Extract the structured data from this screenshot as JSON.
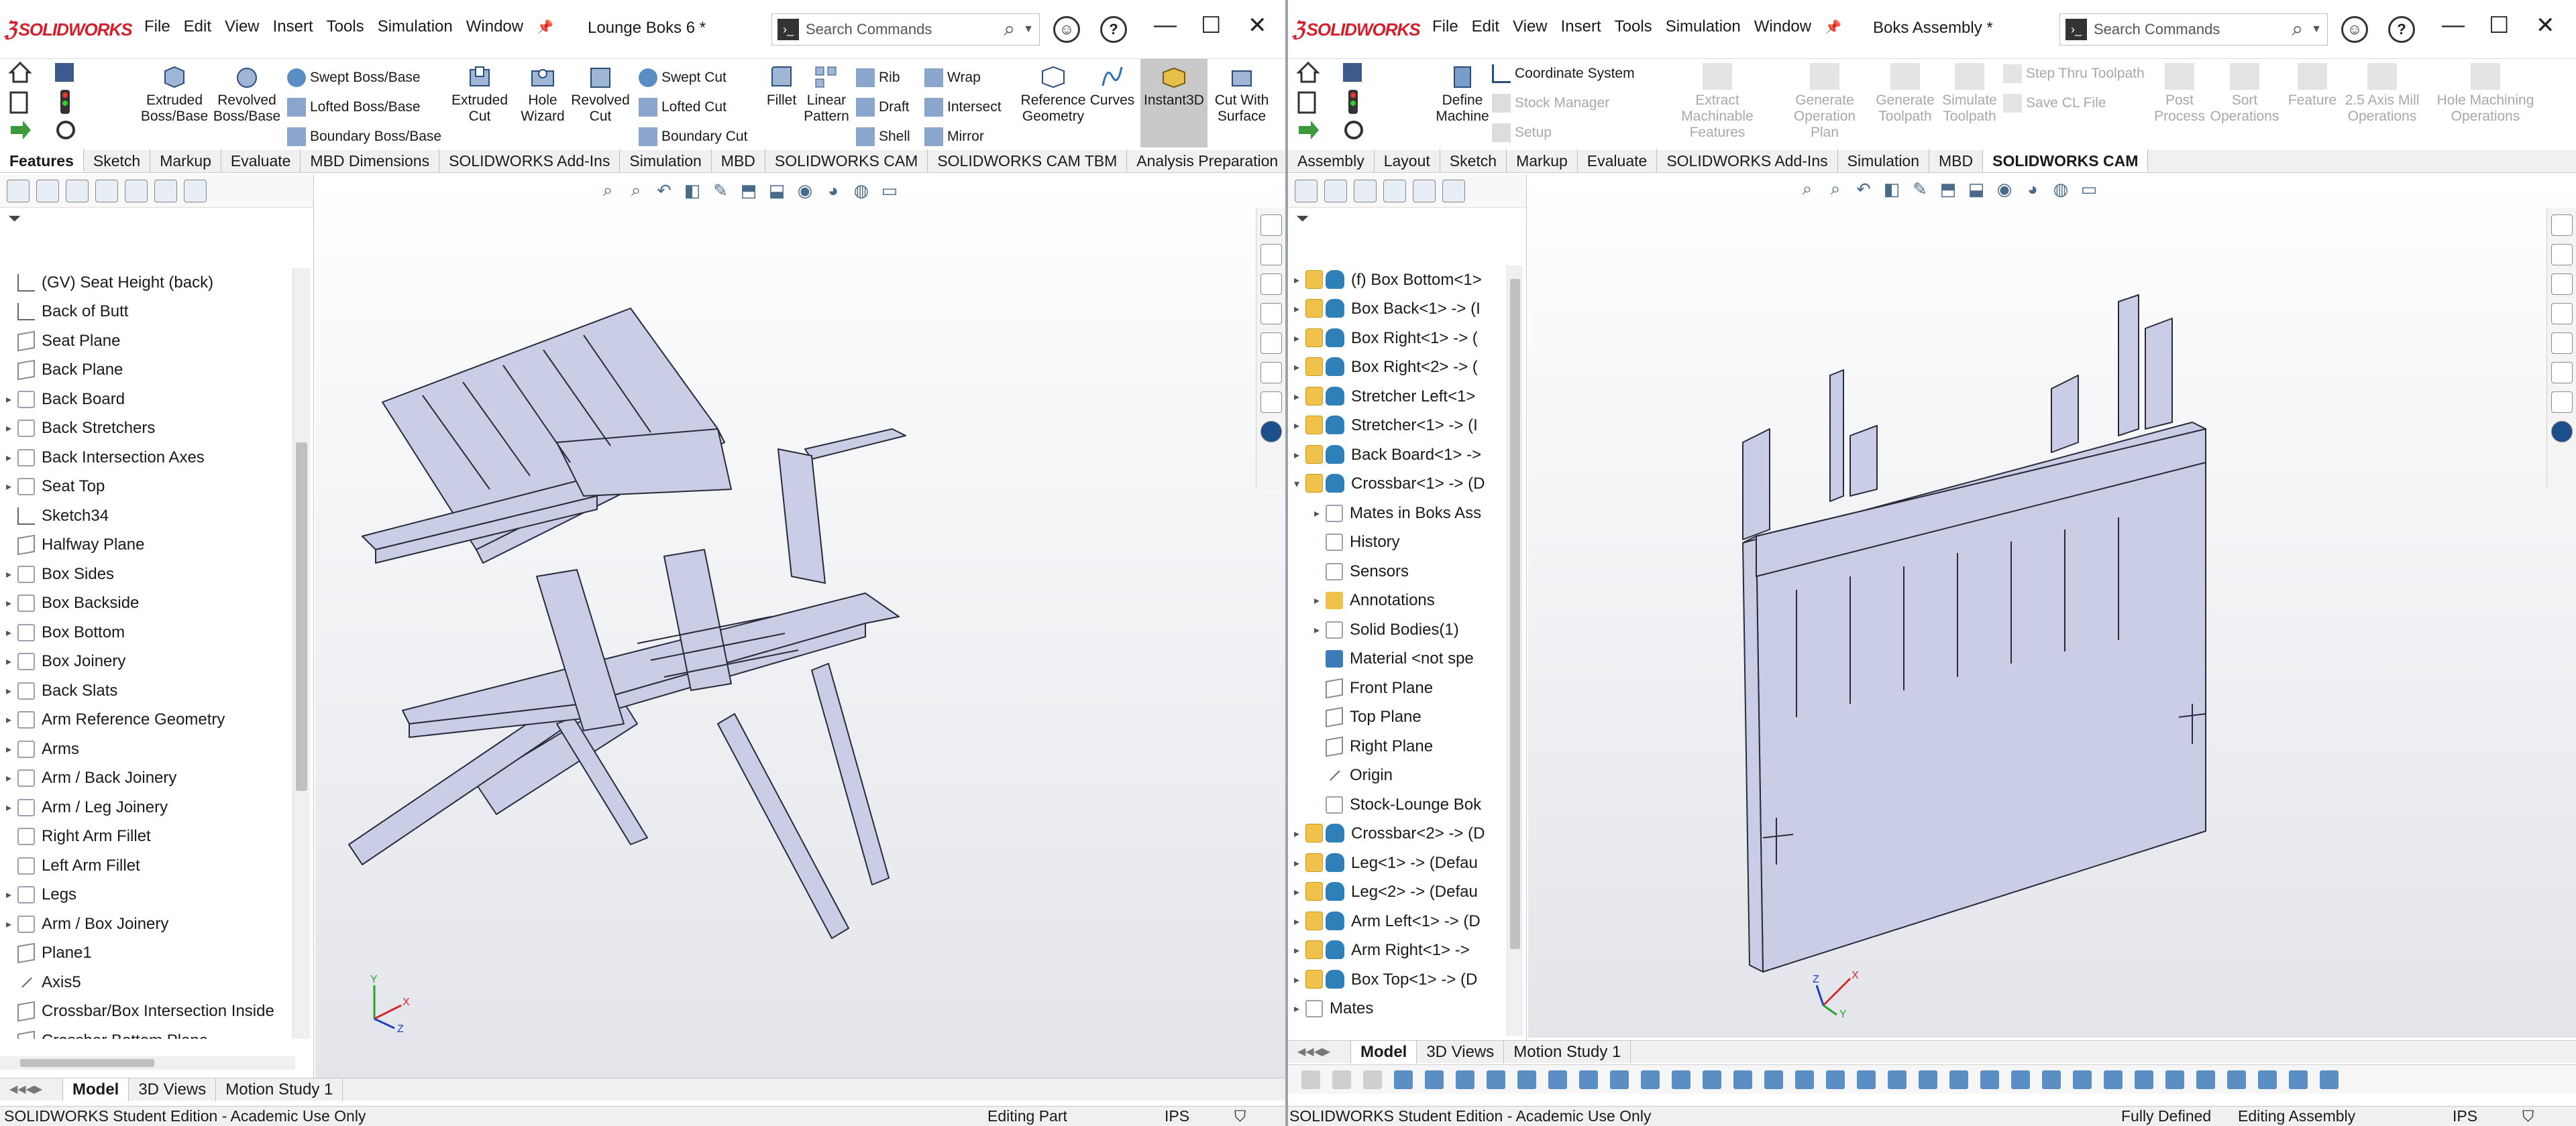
{
  "left": {
    "logo": "SOLIDWORKS",
    "menu": [
      "File",
      "Edit",
      "View",
      "Insert",
      "Tools",
      "Simulation",
      "Window"
    ],
    "doc_title": "Lounge Boks 6 *",
    "search_placeholder": "Search Commands",
    "ribbon": {
      "extruded_boss": "Extruded Boss/Base",
      "revolved_boss": "Revolved Boss/Base",
      "swept_boss": "Swept Boss/Base",
      "lofted_boss": "Lofted Boss/Base",
      "boundary_boss": "Boundary Boss/Base",
      "extruded_cut": "Extruded Cut",
      "hole_wizard": "Hole Wizard",
      "revolved_cut": "Revolved Cut",
      "swept_cut": "Swept Cut",
      "lofted_cut": "Lofted Cut",
      "boundary_cut": "Boundary Cut",
      "fillet": "Fillet",
      "linear_pattern": "Linear Pattern",
      "rib": "Rib",
      "draft": "Draft",
      "shell": "Shell",
      "wrap": "Wrap",
      "intersect": "Intersect",
      "mirror": "Mirror",
      "reference_geometry": "Reference Geometry",
      "curves": "Curves",
      "instant3d": "Instant3D",
      "cut_with_surface": "Cut With Surface"
    },
    "tabs": [
      "Features",
      "Sketch",
      "Markup",
      "Evaluate",
      "MBD Dimensions",
      "SOLIDWORKS Add-Ins",
      "Simulation",
      "MBD",
      "SOLIDWORKS CAM",
      "SOLIDWORKS CAM TBM",
      "Analysis Preparation"
    ],
    "tree": [
      {
        "label": "(GV) Seat Height (back)",
        "icon": "sketch",
        "expand": false
      },
      {
        "label": "Back of Butt",
        "icon": "sketch",
        "expand": false
      },
      {
        "label": "Seat Plane",
        "icon": "plane",
        "expand": false
      },
      {
        "label": "Back Plane",
        "icon": "plane",
        "expand": false
      },
      {
        "label": "Back Board",
        "icon": "folder",
        "expand": true
      },
      {
        "label": "Back Stretchers",
        "icon": "folder",
        "expand": true
      },
      {
        "label": "Back Intersection Axes",
        "icon": "folder",
        "expand": true
      },
      {
        "label": "Seat Top",
        "icon": "folder",
        "expand": true
      },
      {
        "label": "Sketch34",
        "icon": "sketch",
        "expand": false
      },
      {
        "label": "Halfway Plane",
        "icon": "plane",
        "expand": false
      },
      {
        "label": "Box Sides",
        "icon": "folder",
        "expand": true
      },
      {
        "label": "Box Backside",
        "icon": "folder",
        "expand": true
      },
      {
        "label": "Box Bottom",
        "icon": "folder",
        "expand": true
      },
      {
        "label": "Box Joinery",
        "icon": "folder",
        "expand": true
      },
      {
        "label": "Back Slats",
        "icon": "folder",
        "expand": true
      },
      {
        "label": "Arm Reference Geometry",
        "icon": "folder",
        "expand": true
      },
      {
        "label": "Arms",
        "icon": "folder",
        "expand": true
      },
      {
        "label": "Arm / Back Joinery",
        "icon": "folder",
        "expand": true
      },
      {
        "label": "Arm / Leg Joinery",
        "icon": "folder",
        "expand": true
      },
      {
        "label": "Right Arm Fillet",
        "icon": "folder",
        "expand": false
      },
      {
        "label": "Left Arm Fillet",
        "icon": "folder",
        "expand": false
      },
      {
        "label": "Legs",
        "icon": "folder",
        "expand": true
      },
      {
        "label": "Arm / Box Joinery",
        "icon": "folder",
        "expand": true
      },
      {
        "label": "Plane1",
        "icon": "plane",
        "expand": false
      },
      {
        "label": "Axis5",
        "icon": "axis",
        "expand": false
      },
      {
        "label": "Crossbar/Box Intersection Inside",
        "icon": "plane",
        "expand": false
      },
      {
        "label": "Crossbar Bottom Plane",
        "icon": "plane",
        "expand": false
      }
    ],
    "bottom_tabs": [
      "Model",
      "3D Views",
      "Motion Study 1"
    ],
    "status": {
      "edition": "SOLIDWORKS Student Edition - Academic Use Only",
      "mode": "Editing Part",
      "units": "IPS"
    }
  },
  "right": {
    "logo": "SOLIDWORKS",
    "menu": [
      "File",
      "Edit",
      "View",
      "Insert",
      "Tools",
      "Simulation",
      "Window"
    ],
    "doc_title": "Boks Assembly *",
    "search_placeholder": "Search Commands",
    "ribbon": {
      "define_machine": "Define Machine",
      "coordinate_system": "Coordinate System",
      "stock_manager": "Stock Manager",
      "setup": "Setup",
      "extract_features": "Extract Machinable Features",
      "generate_op_plan": "Generate Operation Plan",
      "generate_toolpath": "Generate Toolpath",
      "simulate_toolpath": "Simulate Toolpath",
      "step_thru": "Step Thru Toolpath",
      "save_cl": "Save CL File",
      "post_process": "Post Process",
      "sort_operations": "Sort Operations",
      "feature": "Feature",
      "axis_mill": "2.5 Axis Mill Operations",
      "hole_machining": "Hole Machining Operations"
    },
    "tabs": [
      "Assembly",
      "Layout",
      "Sketch",
      "Markup",
      "Evaluate",
      "SOLIDWORKS Add-Ins",
      "Simulation",
      "MBD",
      "SOLIDWORKS CAM"
    ],
    "tree": [
      {
        "label": "(f) Box Bottom<1>",
        "icon": "asm",
        "expand": true,
        "indent": 0
      },
      {
        "label": "Box Back<1> -> (I",
        "icon": "asm",
        "expand": true,
        "indent": 0
      },
      {
        "label": "Box Right<1> -> (",
        "icon": "asm",
        "expand": true,
        "indent": 0
      },
      {
        "label": "Box Right<2> -> (",
        "icon": "asm",
        "expand": true,
        "indent": 0
      },
      {
        "label": "Stretcher Left<1>",
        "icon": "asm",
        "expand": true,
        "indent": 0
      },
      {
        "label": "Stretcher<1> -> (I",
        "icon": "asm",
        "expand": true,
        "indent": 0
      },
      {
        "label": "Back Board<1> ->",
        "icon": "asm",
        "expand": true,
        "indent": 0
      },
      {
        "label": "Crossbar<1> -> (D",
        "icon": "asm",
        "expand": true,
        "open": true,
        "indent": 0
      },
      {
        "label": "Mates in Boks Ass",
        "icon": "folder",
        "expand": true,
        "indent": 1
      },
      {
        "label": "History",
        "icon": "folder",
        "expand": false,
        "indent": 1
      },
      {
        "label": "Sensors",
        "icon": "folder",
        "expand": false,
        "indent": 1
      },
      {
        "label": "Annotations",
        "icon": "yel",
        "expand": true,
        "indent": 1
      },
      {
        "label": "Solid Bodies(1)",
        "icon": "folder",
        "expand": true,
        "indent": 1
      },
      {
        "label": "Material <not spe",
        "icon": "blue",
        "expand": false,
        "indent": 1
      },
      {
        "label": "Front Plane",
        "icon": "plane",
        "expand": false,
        "indent": 1
      },
      {
        "label": "Top Plane",
        "icon": "plane",
        "expand": false,
        "indent": 1
      },
      {
        "label": "Right Plane",
        "icon": "plane",
        "expand": false,
        "indent": 1
      },
      {
        "label": "Origin",
        "icon": "axis",
        "expand": false,
        "indent": 1
      },
      {
        "label": "Stock-Lounge Bok",
        "icon": "folder",
        "expand": false,
        "indent": 1
      },
      {
        "label": "Crossbar<2> -> (D",
        "icon": "asm",
        "expand": true,
        "indent": 0
      },
      {
        "label": "Leg<1> -> (Defau",
        "icon": "asm",
        "expand": true,
        "indent": 0
      },
      {
        "label": "Leg<2> -> (Defau",
        "icon": "asm",
        "expand": true,
        "indent": 0
      },
      {
        "label": "Arm Left<1> -> (D",
        "icon": "asm",
        "expand": true,
        "indent": 0
      },
      {
        "label": "Arm Right<1> ->",
        "icon": "asm",
        "expand": true,
        "indent": 0
      },
      {
        "label": "Box Top<1> -> (D",
        "icon": "asm",
        "expand": true,
        "indent": 0
      },
      {
        "label": "Mates",
        "icon": "folder",
        "expand": true,
        "indent": 0
      }
    ],
    "bottom_tabs": [
      "Model",
      "3D Views",
      "Motion Study 1"
    ],
    "status": {
      "edition": "SOLIDWORKS Student Edition - Academic Use Only",
      "defined": "Fully Defined",
      "mode": "Editing Assembly",
      "units": "IPS"
    }
  },
  "colors": {
    "accent": "#d31f2b",
    "model_fill": "#c9cde6",
    "model_edge": "#2a2a3a"
  }
}
